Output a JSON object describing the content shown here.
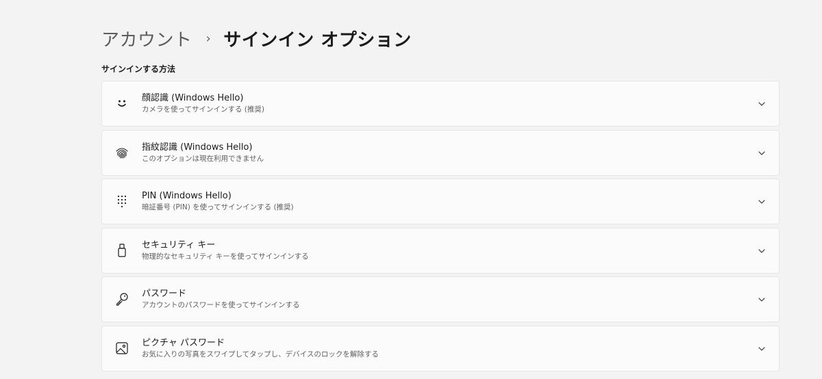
{
  "breadcrumb": {
    "parent": "アカウント",
    "separator": "›",
    "current": "サインイン オプション"
  },
  "section": {
    "title": "サインインする方法"
  },
  "options": [
    {
      "icon": "face-icon",
      "title": "顔認識 (Windows Hello)",
      "subtitle": "カメラを使ってサインインする (推奨)"
    },
    {
      "icon": "fingerprint-icon",
      "title": "指紋認識 (Windows Hello)",
      "subtitle": "このオプションは現在利用できません"
    },
    {
      "icon": "pin-keypad-icon",
      "title": "PIN (Windows Hello)",
      "subtitle": "暗証番号 (PIN) を使ってサインインする (推奨)"
    },
    {
      "icon": "usb-key-icon",
      "title": "セキュリティ キー",
      "subtitle": "物理的なセキュリティ キーを使ってサインインする"
    },
    {
      "icon": "key-icon",
      "title": "パスワード",
      "subtitle": "アカウントのパスワードを使ってサインインする"
    },
    {
      "icon": "picture-icon",
      "title": "ピクチャ パスワード",
      "subtitle": "お気に入りの写真をスワイプしてタップし、デバイスのロックを解除する"
    }
  ],
  "colors": {
    "background": "#f3f3f3",
    "card": "#fbfbfb",
    "card_border": "#e5e5e5",
    "text_primary": "#1a1a1a",
    "text_secondary": "#5f5f5f"
  }
}
